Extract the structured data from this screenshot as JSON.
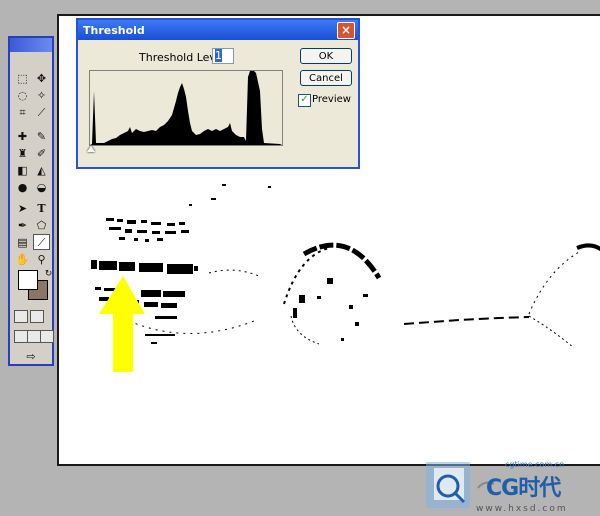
{
  "dialog": {
    "title": "Threshold",
    "close_symbol": "×",
    "threshold_label": "Threshold Level:",
    "threshold_value": "1",
    "ok_label": "OK",
    "cancel_label": "Cancel",
    "preview_label": "Preview",
    "preview_checked": true,
    "histogram_icon": "histogram-chart"
  },
  "toolbox": {
    "foreground_color": "#ffffff",
    "background_color": "#8b7665",
    "text_tool_glyph": "T"
  },
  "canvas": {
    "background": "#ffffff",
    "annotation": "yellow-arrow"
  },
  "watermark": {
    "brand": "CG时代",
    "url": "www.hxsd.com",
    "url_small": "cgtime.com.cn"
  }
}
